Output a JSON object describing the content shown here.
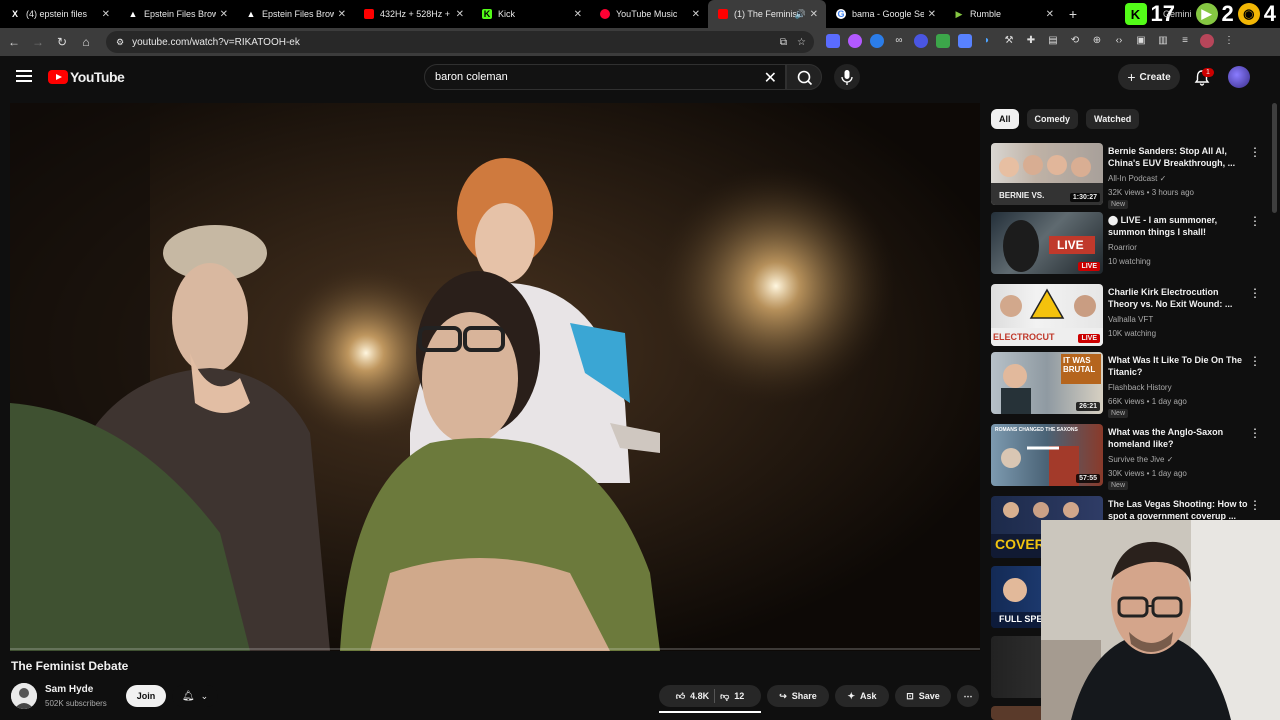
{
  "browser": {
    "tabs": [
      {
        "title": "(4) epstein files",
        "favicon": "x-icon"
      },
      {
        "title": "Epstein Files Browse",
        "favicon": "drive-icon"
      },
      {
        "title": "Epstein Files Browse",
        "favicon": "drive-icon"
      },
      {
        "title": "432Hz + 528Hz + 7",
        "favicon": "youtube-icon"
      },
      {
        "title": "Kick",
        "favicon": "kick-icon"
      },
      {
        "title": "YouTube Music",
        "favicon": "youtube-music-icon"
      },
      {
        "title": "(1) The Feminist",
        "favicon": "youtube-icon",
        "active": true
      },
      {
        "title": "bama - Google Sea",
        "favicon": "google-icon"
      },
      {
        "title": "Rumble",
        "favicon": "rumble-icon"
      }
    ],
    "new_tab": "+",
    "ext_tab_label": "Gemini",
    "counter_17": "17",
    "counter_2": "2",
    "counter_4": "4",
    "url": "youtube.com/watch?v=RIKATOOH-ek"
  },
  "header": {
    "logo_text": "YouTube",
    "search_value": "baron coleman",
    "create_label": "Create",
    "notif_count": "1"
  },
  "video": {
    "title": "The Feminist Debate",
    "channel": "Sam Hyde",
    "subscribers": "502K subscribers",
    "join_label": "Join",
    "likes": "4.8K",
    "dislikes": "12",
    "share_label": "Share",
    "ask_label": "Ask",
    "save_label": "Save",
    "more_label": "⋯"
  },
  "chips": [
    "All",
    "Comedy",
    "Watched"
  ],
  "recommendations": [
    {
      "title": "Bernie Sanders: Stop All AI, China's EUV Breakthrough, ...",
      "channel": "All-In Podcast",
      "meta": "32K views • 3 hours ago",
      "badge": "New",
      "duration": "1:30:27",
      "thumb_text": "BERNIE VS."
    },
    {
      "title": "⬤ LIVE - I am summoner, summon things I shall!",
      "channel": "Roarrior",
      "meta": "10 watching",
      "badge": "",
      "live": "LIVE",
      "thumb_text": "LIVE"
    },
    {
      "title": "Charlie Kirk Electrocution Theory vs. No Exit Wound: ...",
      "channel": "Valhalla VFT",
      "meta": "10K watching",
      "badge": "",
      "live": "LIVE",
      "thumb_text": "ELECTROCUT"
    },
    {
      "title": "What Was It Like To Die On The Titanic?",
      "channel": "Flashback History",
      "meta": "66K views • 1 day ago",
      "badge": "New",
      "duration": "26:21",
      "thumb_text": "IT WAS BRUTAL"
    },
    {
      "title": "What was the Anglo-Saxon homeland like?",
      "channel": "Survive the Jive",
      "meta": "30K views • 1 day ago",
      "badge": "New",
      "duration": "57:55",
      "thumb_text": "ROMANS CHANGED THE SAXONS"
    },
    {
      "title": "The Las Vegas Shooting: How to spot a government coverup ...",
      "channel": "",
      "meta": "",
      "badge": "",
      "thumb_text": "COVER"
    },
    {
      "title": "",
      "channel": "",
      "meta": "",
      "badge": "",
      "thumb_text": "FULL SPEE"
    }
  ],
  "colors": {
    "bg": "#0f0f0f",
    "accent": "#ff0000",
    "chip": "#272727"
  }
}
